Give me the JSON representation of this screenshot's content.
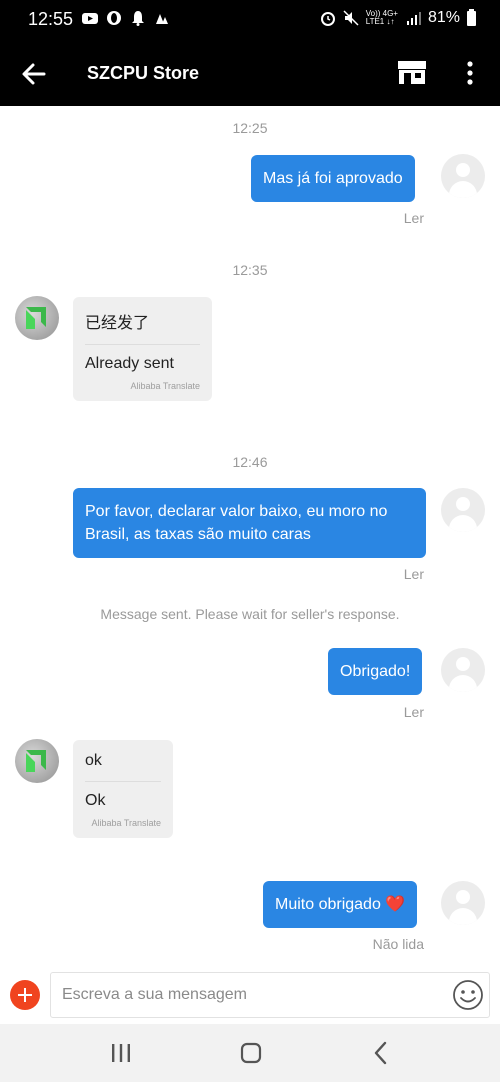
{
  "status_bar": {
    "time": "12:55",
    "battery": "81%",
    "network_top": "Vo)) 4G+",
    "network_bottom": "LTE1 ↓↑"
  },
  "header": {
    "title": "SZCPU Store"
  },
  "messages": [
    {
      "time": "12:25"
    },
    {
      "text": "Mas já foi aprovado",
      "status": "Ler"
    },
    {
      "time": "12:35"
    },
    {
      "original": "已经发了",
      "translation": "Already sent",
      "credit": "Alibaba Translate"
    },
    {
      "time": "12:46"
    },
    {
      "text": "Por favor, declarar valor baixo, eu moro no Brasil, as taxas são muito caras",
      "status": "Ler"
    },
    {
      "system": "Message sent. Please wait for seller's response."
    },
    {
      "text": "Obrigado!",
      "status": "Ler"
    },
    {
      "original": "ok",
      "translation": "Ok",
      "credit": "Alibaba Translate"
    },
    {
      "text": "Muito obrigado",
      "emoji": "❤️",
      "status": "Não lida"
    }
  ],
  "composer": {
    "placeholder": "Escreva a sua mensagem"
  },
  "colors": {
    "accent_blue": "#2a86e3",
    "add_button_red": "#f0441f",
    "seller_bubble": "#efefef"
  },
  "icons": [
    "back-arrow-icon",
    "store-icon",
    "more-vert-icon",
    "add-icon",
    "emoji-icon",
    "user-avatar-icon",
    "seller-logo-icon",
    "nav-recent-icon",
    "nav-home-icon",
    "nav-back-icon"
  ]
}
